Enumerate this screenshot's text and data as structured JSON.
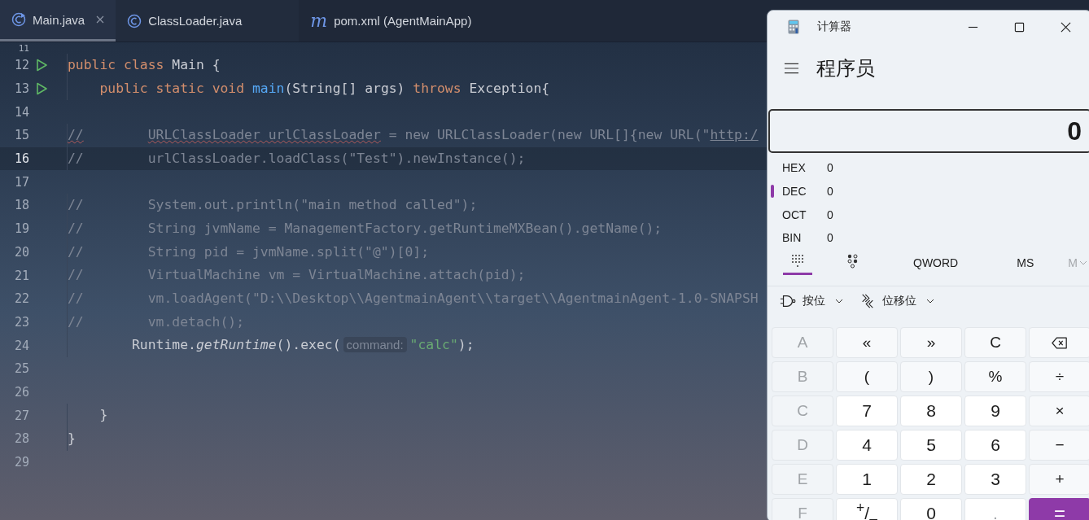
{
  "editor": {
    "tabs": [
      {
        "label": "Main.java",
        "kind": "java_main",
        "selected": true,
        "closable": true
      },
      {
        "label": "ClassLoader.java",
        "kind": "java_class",
        "selected": false,
        "closable": false
      },
      {
        "label": "pom.xml (AgentMainApp)",
        "kind": "maven",
        "icon_text": "m",
        "selected": false,
        "closable": false
      }
    ],
    "lines": [
      {
        "number": "11",
        "current": false,
        "runnable": false
      },
      {
        "number": "12",
        "current": false,
        "runnable": true,
        "tokens": [
          {
            "kind": "keyword",
            "text": "public class "
          },
          {
            "kind": "plain",
            "text": "Main {"
          }
        ]
      },
      {
        "number": "13",
        "current": false,
        "runnable": true,
        "tokens": [
          {
            "kind": "keyword",
            "text": "    public static void "
          },
          {
            "kind": "method",
            "text": "main"
          },
          {
            "kind": "plain",
            "text": "(String[] args) "
          },
          {
            "kind": "keyword",
            "text": "throws "
          },
          {
            "kind": "plain",
            "text": "Exception{"
          }
        ]
      },
      {
        "number": "14",
        "current": false,
        "runnable": false
      },
      {
        "number": "15",
        "current": false,
        "runnable": false,
        "tokens": [
          {
            "kind": "comment_warn",
            "text": "//"
          },
          {
            "kind": "comment_warn",
            "text": "        URLClassLoader urlClassLoader"
          },
          {
            "kind": "comment",
            "text": " = new URLClassLoader(new URL[]{new URL(\""
          },
          {
            "kind": "comment_link",
            "text": "http:/"
          }
        ]
      },
      {
        "number": "16",
        "current": true,
        "runnable": false,
        "tokens": [
          {
            "kind": "comment",
            "text": "//        urlClassLoader.loadClass(\"Test\").newInstance();"
          }
        ]
      },
      {
        "number": "17",
        "current": false,
        "runnable": false
      },
      {
        "number": "18",
        "current": false,
        "runnable": false,
        "tokens": [
          {
            "kind": "comment",
            "text": "//        System.out.println(\"main method called\");"
          }
        ]
      },
      {
        "number": "19",
        "current": false,
        "runnable": false,
        "tokens": [
          {
            "kind": "comment",
            "text": "//        String jvmName = ManagementFactory.getRuntimeMXBean().getName();"
          }
        ]
      },
      {
        "number": "20",
        "current": false,
        "runnable": false,
        "tokens": [
          {
            "kind": "comment",
            "text": "//        String pid = jvmName.split(\"@\")[0];"
          }
        ]
      },
      {
        "number": "21",
        "current": false,
        "runnable": false,
        "tokens": [
          {
            "kind": "comment",
            "text": "//        VirtualMachine vm = VirtualMachine.attach(pid);"
          }
        ]
      },
      {
        "number": "22",
        "current": false,
        "runnable": false,
        "tokens": [
          {
            "kind": "comment",
            "text": "//        vm.loadAgent(\"D:\\\\Desktop\\\\AgentmainAgent\\\\target\\\\AgentmainAgent-1.0-SNAPSH"
          }
        ]
      },
      {
        "number": "23",
        "current": false,
        "runnable": false,
        "tokens": [
          {
            "kind": "comment",
            "text": "//        vm.detach();"
          }
        ]
      },
      {
        "number": "24",
        "current": false,
        "runnable": false,
        "tokens": [
          {
            "kind": "plain",
            "text": "        Runtime."
          },
          {
            "kind": "italic",
            "text": "getRuntime"
          },
          {
            "kind": "plain",
            "text": "().exec("
          },
          {
            "kind": "hint",
            "text": "command:"
          },
          {
            "kind": "string",
            "text": "\"calc\""
          },
          {
            "kind": "plain",
            "text": ");"
          }
        ]
      },
      {
        "number": "25",
        "current": false,
        "runnable": false
      },
      {
        "number": "26",
        "current": false,
        "runnable": false
      },
      {
        "number": "27",
        "current": false,
        "runnable": false,
        "tokens": [
          {
            "kind": "plain",
            "text": "    }"
          }
        ]
      },
      {
        "number": "28",
        "current": false,
        "runnable": false,
        "tokens": [
          {
            "kind": "plain",
            "text": "}"
          }
        ]
      },
      {
        "number": "29",
        "current": false,
        "runnable": false
      }
    ]
  },
  "calculator": {
    "title": "计算器",
    "mode": "程序员",
    "display": "0",
    "radix": [
      {
        "label": "HEX",
        "value": "0",
        "selected": false
      },
      {
        "label": "DEC",
        "value": "0",
        "selected": true
      },
      {
        "label": "OCT",
        "value": "0",
        "selected": false
      },
      {
        "label": "BIN",
        "value": "0",
        "selected": false
      }
    ],
    "views": [
      {
        "kind": "keypad",
        "selected": true
      },
      {
        "kind": "bits",
        "selected": false
      }
    ],
    "word_size": "QWORD",
    "memory": [
      {
        "label": "MS",
        "disabled": false,
        "dropdown": false
      },
      {
        "label": "M",
        "disabled": true,
        "dropdown": true
      }
    ],
    "tools": [
      {
        "kind": "bitwise",
        "label": "按位"
      },
      {
        "kind": "shift",
        "label": "位移位"
      }
    ],
    "keys": [
      {
        "label": "A",
        "kind": "hex",
        "disabled": true
      },
      {
        "label": "«",
        "kind": "op",
        "disabled": false
      },
      {
        "label": "»",
        "kind": "op",
        "disabled": false
      },
      {
        "label": "C",
        "kind": "op",
        "disabled": false
      },
      {
        "kind": "backspace",
        "disabled": false
      },
      {
        "label": "B",
        "kind": "hex",
        "disabled": true
      },
      {
        "label": "(",
        "kind": "op",
        "disabled": false
      },
      {
        "label": ")",
        "kind": "op",
        "disabled": false
      },
      {
        "label": "%",
        "kind": "op",
        "disabled": false
      },
      {
        "label": "÷",
        "kind": "op",
        "disabled": false
      },
      {
        "label": "C",
        "kind": "hex",
        "disabled": true
      },
      {
        "label": "7",
        "kind": "digit",
        "disabled": false
      },
      {
        "label": "8",
        "kind": "digit",
        "disabled": false
      },
      {
        "label": "9",
        "kind": "digit",
        "disabled": false
      },
      {
        "label": "×",
        "kind": "op",
        "disabled": false
      },
      {
        "label": "D",
        "kind": "hex",
        "disabled": true
      },
      {
        "label": "4",
        "kind": "digit",
        "disabled": false
      },
      {
        "label": "5",
        "kind": "digit",
        "disabled": false
      },
      {
        "label": "6",
        "kind": "digit",
        "disabled": false
      },
      {
        "label": "−",
        "kind": "op",
        "disabled": false
      },
      {
        "label": "E",
        "kind": "hex",
        "disabled": true
      },
      {
        "label": "1",
        "kind": "digit",
        "disabled": false
      },
      {
        "label": "2",
        "kind": "digit",
        "disabled": false
      },
      {
        "label": "3",
        "kind": "digit",
        "disabled": false
      },
      {
        "label": "+",
        "kind": "op",
        "disabled": false
      },
      {
        "label": "F",
        "kind": "hex",
        "disabled": true
      },
      {
        "label": "$^{+}$/$_{–}$",
        "kind": "digit",
        "disabled": false
      },
      {
        "label": "0",
        "kind": "digit",
        "disabled": false
      },
      {
        "label": ".",
        "kind": "digit",
        "disabled": true
      },
      {
        "label": "=",
        "kind": "equals",
        "disabled": false
      }
    ]
  }
}
